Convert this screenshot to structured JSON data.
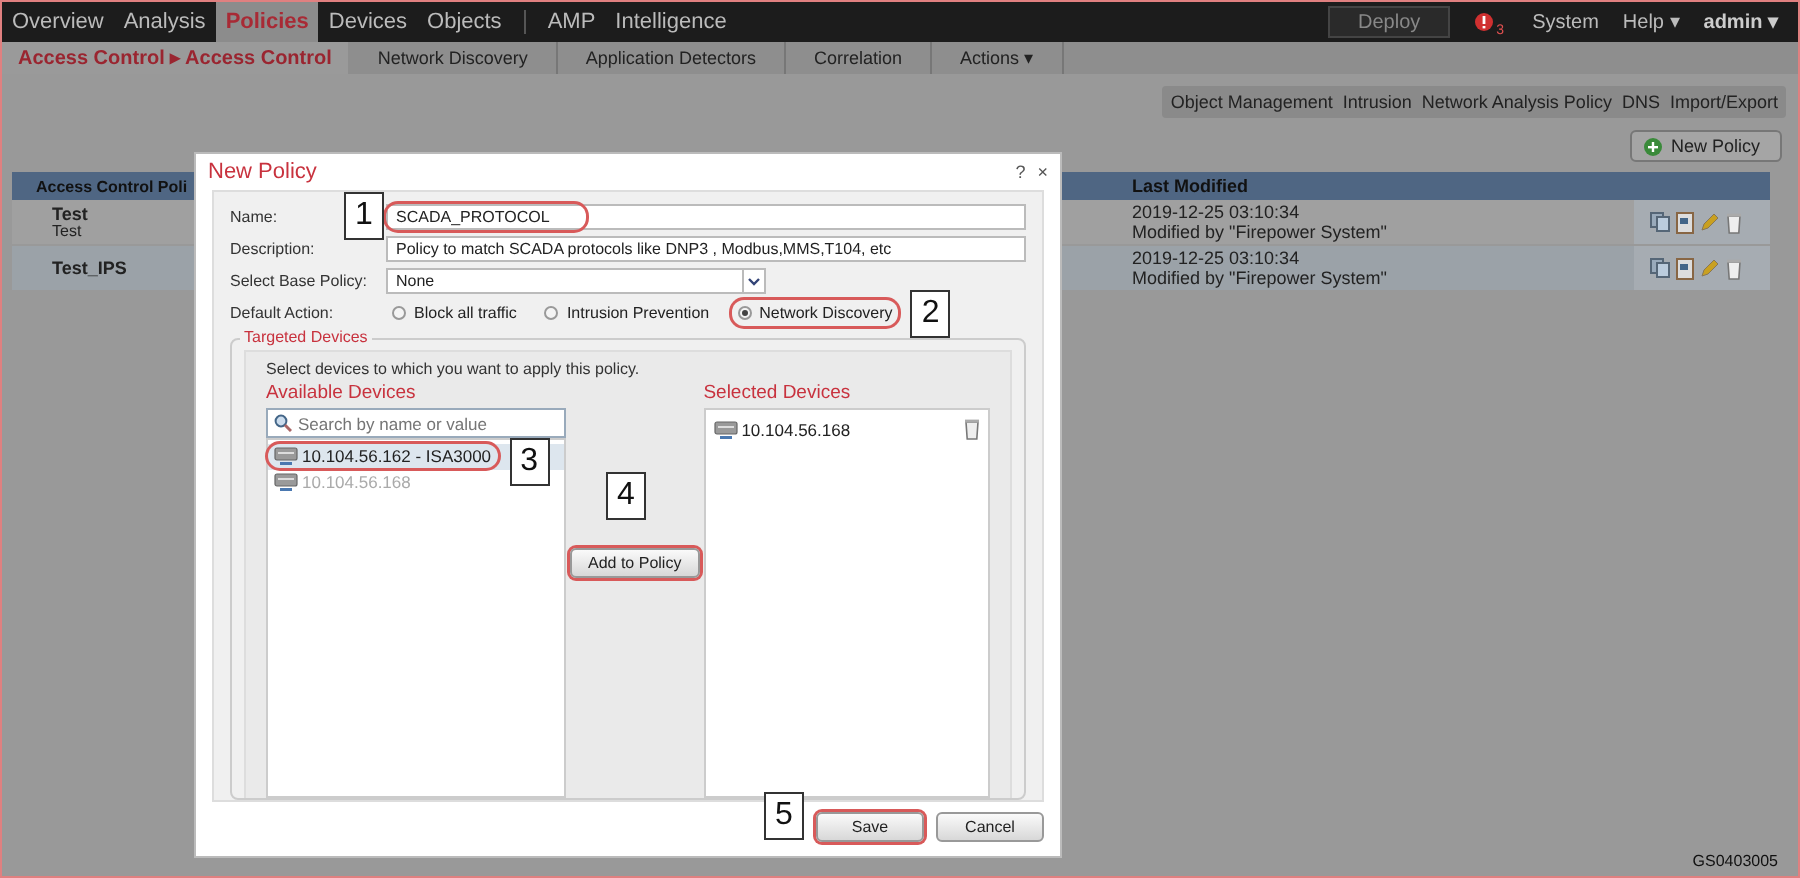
{
  "nav": {
    "items": [
      {
        "label": "Overview",
        "selected": false
      },
      {
        "label": "Analysis",
        "selected": false
      },
      {
        "label": "Policies",
        "selected": true
      },
      {
        "label": "Devices",
        "selected": false
      },
      {
        "label": "Objects",
        "selected": false
      },
      {
        "label": "AMP",
        "selected": false
      },
      {
        "label": "Intelligence",
        "selected": false
      }
    ],
    "deploy": "Deploy",
    "alert_count": "3",
    "system": "System",
    "help": "Help ▾",
    "user": "admin ▾"
  },
  "subnav": {
    "breadcrumb": "Access Control ▸ Access Control",
    "tabs": [
      "Network Discovery",
      "Application Detectors",
      "Correlation",
      "Actions ▾"
    ]
  },
  "toolbar_links": [
    "Object Management",
    "Intrusion",
    "Network Analysis Policy",
    "DNS",
    "Import/Export"
  ],
  "new_policy_button": "New Policy",
  "table": {
    "columns": [
      "Access Control Poli",
      "Last Modified"
    ],
    "rows": [
      {
        "name": "Test",
        "description": "Test",
        "modified": "2019-12-25 03:10:34",
        "modified_by": "Modified by \"Firepower System\""
      },
      {
        "name": "Test_IPS",
        "modified": "2019-12-25 03:10:34",
        "modified_by": "Modified by \"Firepower System\""
      }
    ]
  },
  "dialog": {
    "title": "New Policy",
    "help": "?",
    "close": "×",
    "fields": [
      {
        "kind": "text",
        "label": "Name:",
        "value": "SCADA_PROTOCOL",
        "callout": "1"
      },
      {
        "kind": "text",
        "label": "Description:",
        "value": "Policy to match SCADA protocols like DNP3 , Modbus,MMS,T104, etc"
      },
      {
        "kind": "select",
        "label": "Select Base Policy:",
        "value": "None"
      }
    ],
    "default_action_label": "Default Action:",
    "default_actions": [
      {
        "label": "Block all traffic",
        "selected": false
      },
      {
        "label": "Intrusion Prevention",
        "selected": false
      },
      {
        "label": "Network Discovery",
        "selected": true,
        "callout": "2"
      }
    ],
    "targeted_devices_legend": "Targeted Devices",
    "instruction": "Select devices to which you want to apply this policy.",
    "available_heading": "Available Devices",
    "search_placeholder": "Search by name or value",
    "available_devices": [
      {
        "label": "10.104.56.162 - ISA3000",
        "selected": true,
        "disabled": false,
        "callout": "3"
      },
      {
        "label": "10.104.56.168",
        "selected": false,
        "disabled": true
      }
    ],
    "add_button": {
      "label": "Add to Policy",
      "callout": "4"
    },
    "selected_heading": "Selected Devices",
    "selected_devices": [
      "10.104.56.168"
    ],
    "save_button": {
      "label": "Save",
      "callout": "5"
    },
    "cancel_button": {
      "label": "Cancel"
    }
  },
  "image_id": "GS0403005"
}
